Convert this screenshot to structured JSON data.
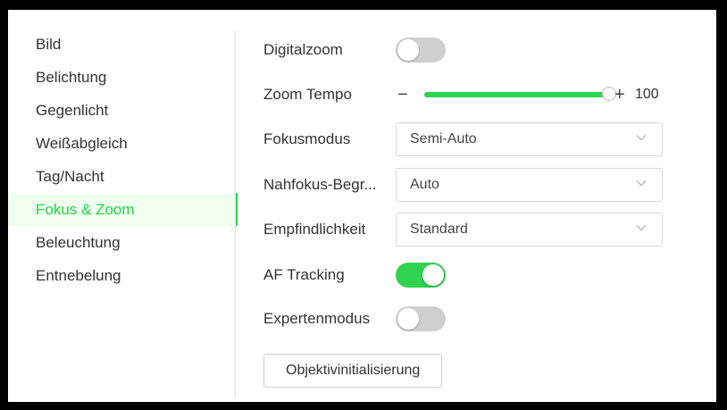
{
  "sidebar": {
    "items": [
      {
        "label": "Bild",
        "active": false
      },
      {
        "label": "Belichtung",
        "active": false
      },
      {
        "label": "Gegenlicht",
        "active": false
      },
      {
        "label": "Weißabgleich",
        "active": false
      },
      {
        "label": "Tag/Nacht",
        "active": false
      },
      {
        "label": "Fokus & Zoom",
        "active": true
      },
      {
        "label": "Beleuchtung",
        "active": false
      },
      {
        "label": "Entnebelung",
        "active": false
      }
    ]
  },
  "form": {
    "digitalzoom": {
      "label": "Digitalzoom",
      "on": false
    },
    "zoom_tempo": {
      "label": "Zoom Tempo",
      "minus": "−",
      "plus": "+",
      "value": 100,
      "min": 0,
      "max": 100
    },
    "fokusmodus": {
      "label": "Fokusmodus",
      "value": "Semi-Auto"
    },
    "nahfokus": {
      "label": "Nahfokus-Begr...",
      "value": "Auto"
    },
    "empfindlichkeit": {
      "label": "Empfindlichkeit",
      "value": "Standard"
    },
    "af_tracking": {
      "label": "AF Tracking",
      "on": true
    },
    "expertenmodus": {
      "label": "Expertenmodus",
      "on": false
    },
    "objektiv_button": "Objektivinitialisierung"
  },
  "colors": {
    "accent": "#2fd34f",
    "active_nav_bg": "#effff0",
    "toggle_off": "#cfcfcf"
  }
}
